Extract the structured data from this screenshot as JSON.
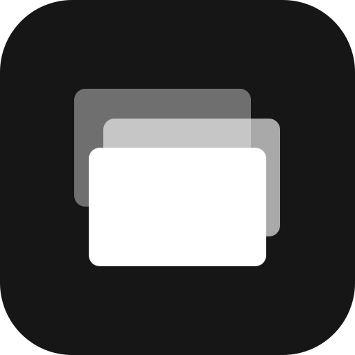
{
  "icon": {
    "name": "stacked-cards-icon",
    "background_color": "#161616",
    "cards": [
      {
        "name": "back-card",
        "color": "#6f6f6f"
      },
      {
        "name": "middle-card",
        "color": "#a9a9a9"
      },
      {
        "name": "middle-card-overlap",
        "color": "#c6c6c6"
      },
      {
        "name": "front-card",
        "color": "#ffffff"
      }
    ]
  }
}
